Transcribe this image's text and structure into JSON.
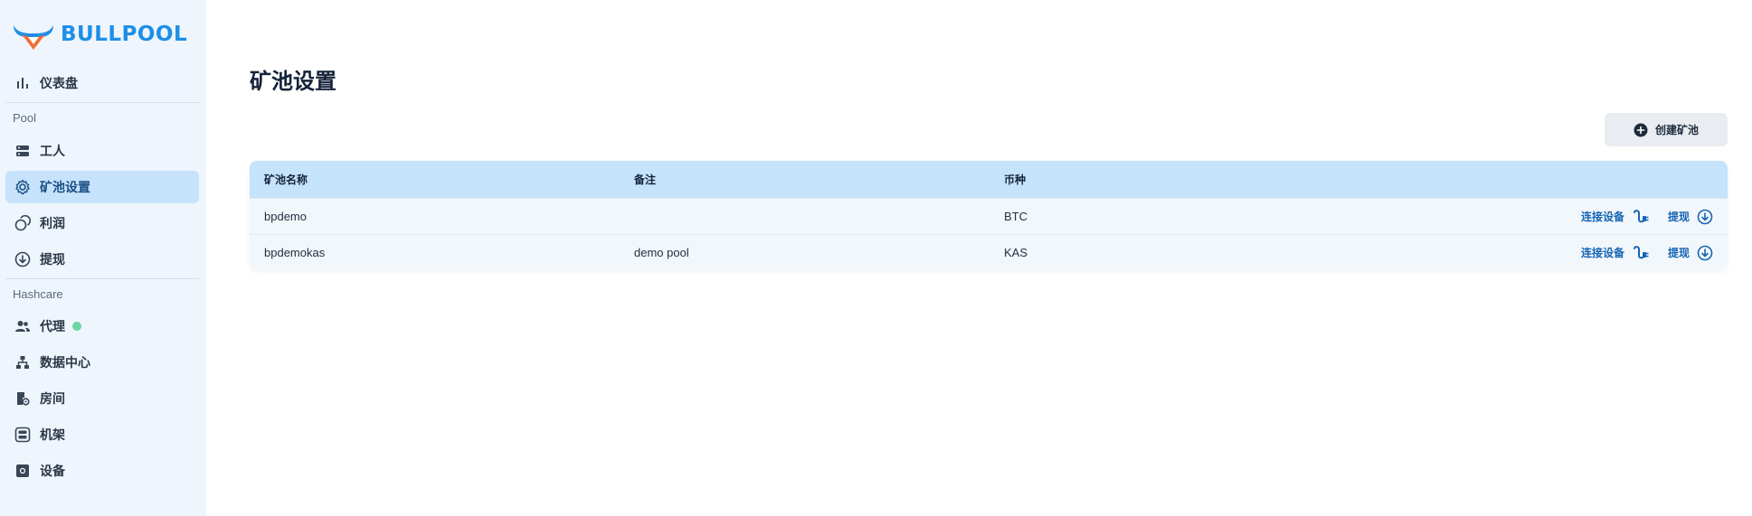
{
  "brand": {
    "name": "BULLPOOL",
    "logo_icon": "bull-logo-icon",
    "accent": "#1d8fe8"
  },
  "sidebar": {
    "dashboard": {
      "label": "仪表盘",
      "icon": "bar-chart-icon"
    },
    "pool_section": "Pool",
    "pool_items": [
      {
        "label": "工人",
        "icon": "server-icon"
      },
      {
        "label": "矿池设置",
        "icon": "gear-icon",
        "active": true
      },
      {
        "label": "利润",
        "icon": "coins-icon"
      },
      {
        "label": "提现",
        "icon": "download-circle-icon"
      }
    ],
    "hashcare_section": "Hashcare",
    "hashcare_items": [
      {
        "label": "代理",
        "icon": "users-icon",
        "status": "online"
      },
      {
        "label": "数据中心",
        "icon": "sitemap-icon"
      },
      {
        "label": "房间",
        "icon": "room-gear-icon"
      },
      {
        "label": "机架",
        "icon": "rack-icon"
      },
      {
        "label": "设备",
        "icon": "device-icon"
      }
    ],
    "active_color": "#c7e3fb",
    "status_color": "#6ed6a0"
  },
  "main": {
    "title": "矿池设置",
    "create_button": {
      "label": "创建矿池",
      "icon": "plus-circle-icon"
    },
    "table": {
      "headers": [
        "矿池名称",
        "备注",
        "币种"
      ],
      "rows": [
        {
          "name": "bpdemo",
          "note": "",
          "coin": "BTC",
          "connect_label": "连接设备",
          "withdraw_label": "提现"
        },
        {
          "name": "bpdemokas",
          "note": "demo pool",
          "coin": "KAS",
          "connect_label": "连接设备",
          "withdraw_label": "提现"
        }
      ],
      "header_bg": "#c5e3fb",
      "link_color": "#1565b3"
    }
  }
}
